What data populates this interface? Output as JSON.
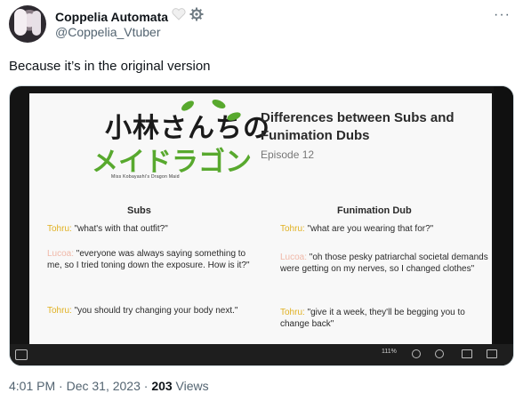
{
  "user": {
    "name": "Coppelia Automata",
    "handle": "@Coppelia_Vtuber"
  },
  "tweet": {
    "text": "Because it’s in the original version"
  },
  "media": {
    "logo": {
      "jp_line1": "小林さんちの",
      "jp_line2": "メイドラゴン",
      "subtitle": "Miss Kobayashi's Dragon Maid"
    },
    "title": "Differences between Subs and Funimation Dubs",
    "episode": "Episode 12",
    "col_subs": "Subs",
    "col_dub": "Funimation Dub",
    "subs": [
      {
        "speaker": "Tohru:",
        "text": " \"what's with that outfit?\""
      },
      {
        "speaker": "Lucoa:",
        "text": " \"everyone was always saying something to me, so I tried toning down the exposure. How is it?\""
      },
      {
        "speaker": "Tohru:",
        "text": " \"you should try changing your body next.\""
      }
    ],
    "dub": [
      {
        "speaker": "Tohru:",
        "text": " \"what are you wearing that for?\""
      },
      {
        "speaker": "Lucoa:",
        "text": " \"oh those pesky patriarchal societal demands were getting on my nerves, so I changed clothes\""
      },
      {
        "speaker": "Tohru:",
        "text": " \"give it a week, they'll be begging you to change back\""
      }
    ],
    "zoom": "111%"
  },
  "meta": {
    "time": "4:01 PM · Dec 31, 2023 · ",
    "views_count": "203",
    "views_label": " Views"
  },
  "icons": [
    "heart-icon",
    "gear-icon",
    "more-icon"
  ]
}
